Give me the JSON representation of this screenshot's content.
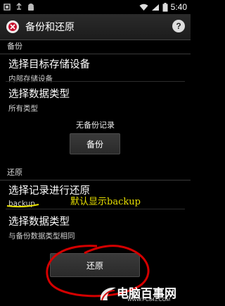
{
  "status_bar": {
    "time": "5:40"
  },
  "action_bar": {
    "title": "备份和还原",
    "help_label": "?"
  },
  "backup_section": {
    "header": "备份",
    "target_title": "选择目标存储设备",
    "target_value": "内部存储设备",
    "type_title": "选择数据类型",
    "type_value": "所有类型",
    "no_records": "无备份记录",
    "backup_button": "备份"
  },
  "restore_section": {
    "header": "还原",
    "record_title": "选择记录进行还原",
    "record_value": "backup",
    "type_title": "选择数据类型",
    "type_value": "与备份数据类型相同",
    "restore_button": "还原"
  },
  "annotation": {
    "text": "默认显示backup",
    "color": "#e8e000",
    "mark_color": "#d40000"
  },
  "watermark": {
    "brand": "电脑百事网",
    "url": "WWW.PC841.COM"
  },
  "colors": {
    "background": "#000000",
    "divider": "#2c2c2c"
  }
}
